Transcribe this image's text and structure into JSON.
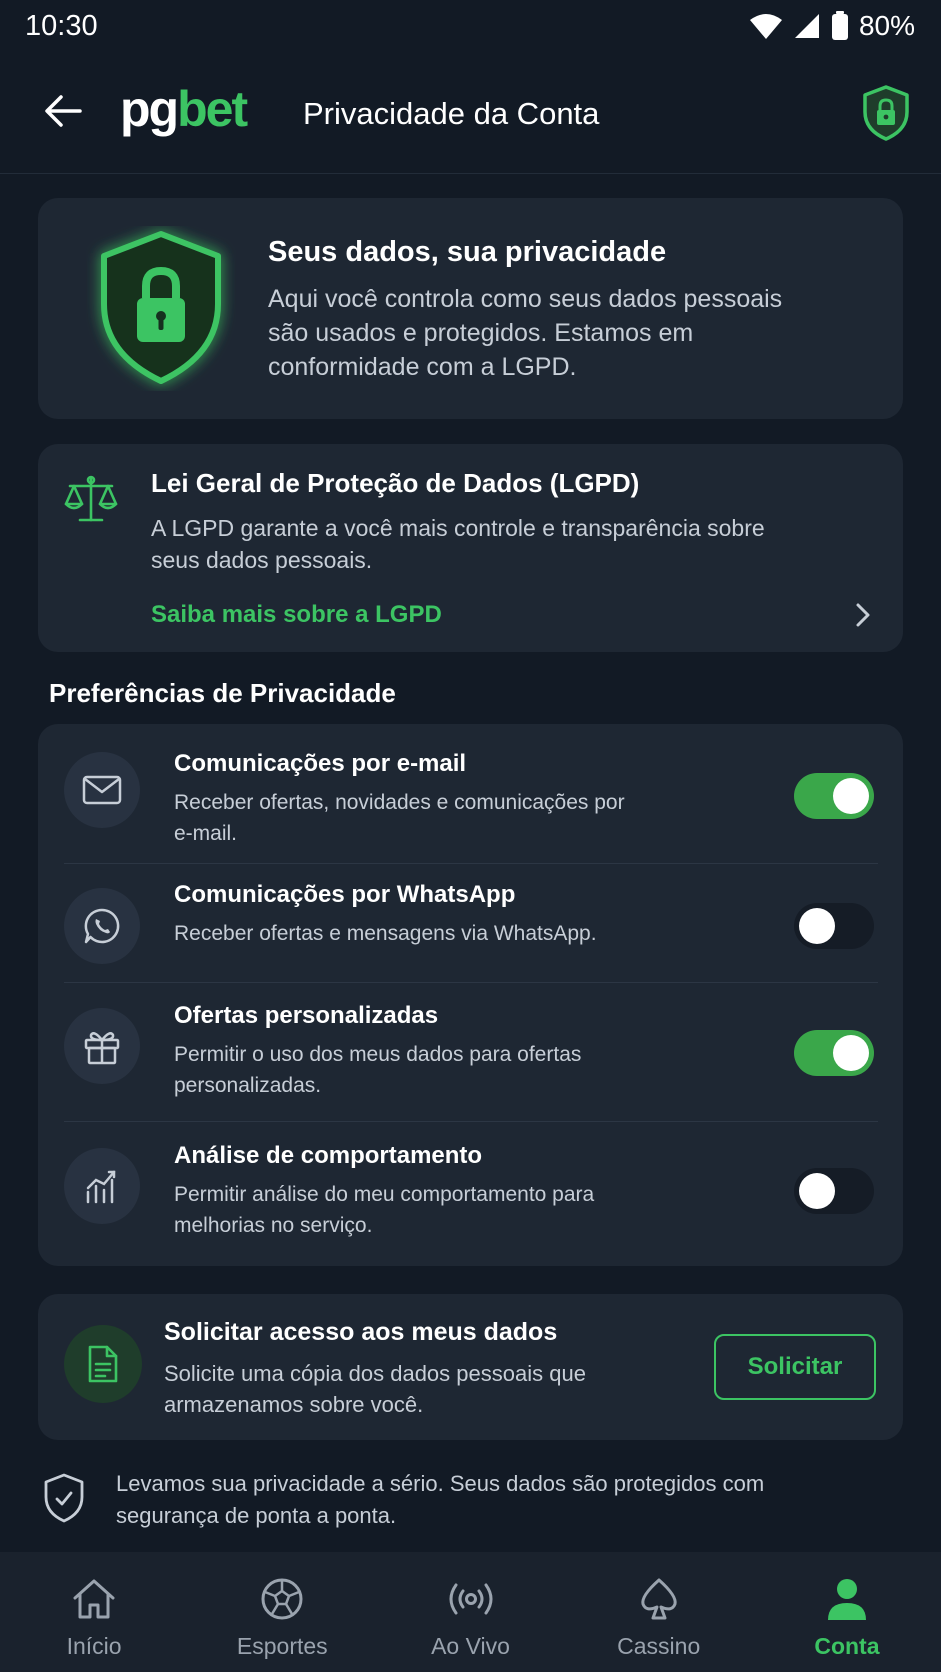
{
  "status_bar": {
    "time": "10:30",
    "battery": "80%"
  },
  "header": {
    "logo_part1": "pg",
    "logo_part2": "bet",
    "title": "Privacidade da Conta"
  },
  "hero": {
    "title": "Seus dados, sua privacidade",
    "text": "Aqui você controla como seus dados pessoais são usados e protegidos. Estamos em conformidade com a LGPD."
  },
  "lgpd": {
    "title": "Lei Geral de Proteção de Dados (LGPD)",
    "text": "A LGPD garante a você mais controle e transparência sobre seus dados pessoais.",
    "link": "Saiba mais sobre a LGPD"
  },
  "preferences": {
    "section_title": "Preferências de Privacidade",
    "items": [
      {
        "title": "Comunicações por e-mail",
        "description": "Receber ofertas, novidades e comunicações por e-mail.",
        "icon": "mail-icon",
        "enabled": true
      },
      {
        "title": "Comunicações por WhatsApp",
        "description": "Receber ofertas e mensagens via WhatsApp.",
        "icon": "whatsapp-icon",
        "enabled": false
      },
      {
        "title": "Ofertas personalizadas",
        "description": "Permitir o uso dos meus dados para ofertas personalizadas.",
        "icon": "gift-icon",
        "enabled": true
      },
      {
        "title": "Análise de comportamento",
        "description": "Permitir análise do meu comportamento para melhorias no serviço.",
        "icon": "analytics-icon",
        "enabled": false
      }
    ]
  },
  "data_access": {
    "title": "Solicitar acesso aos meus dados",
    "text": "Solicite uma cópia dos dados pessoais que armazenamos sobre você.",
    "button": "Solicitar"
  },
  "footer_note": "Levamos sua privacidade a sério. Seus dados são protegidos com segurança de ponta a ponta.",
  "nav": {
    "items": [
      {
        "label": "Início",
        "icon": "home-icon",
        "active": false
      },
      {
        "label": "Esportes",
        "icon": "soccer-ball-icon",
        "active": false
      },
      {
        "label": "Ao Vivo",
        "icon": "live-broadcast-icon",
        "active": false
      },
      {
        "label": "Cassino",
        "icon": "spade-icon",
        "active": false
      },
      {
        "label": "Conta",
        "icon": "user-icon",
        "active": true
      }
    ]
  },
  "colors": {
    "accent": "#3cc463",
    "background": "#121a25",
    "card": "#1e2733",
    "toggle_on": "#3aa74a"
  }
}
